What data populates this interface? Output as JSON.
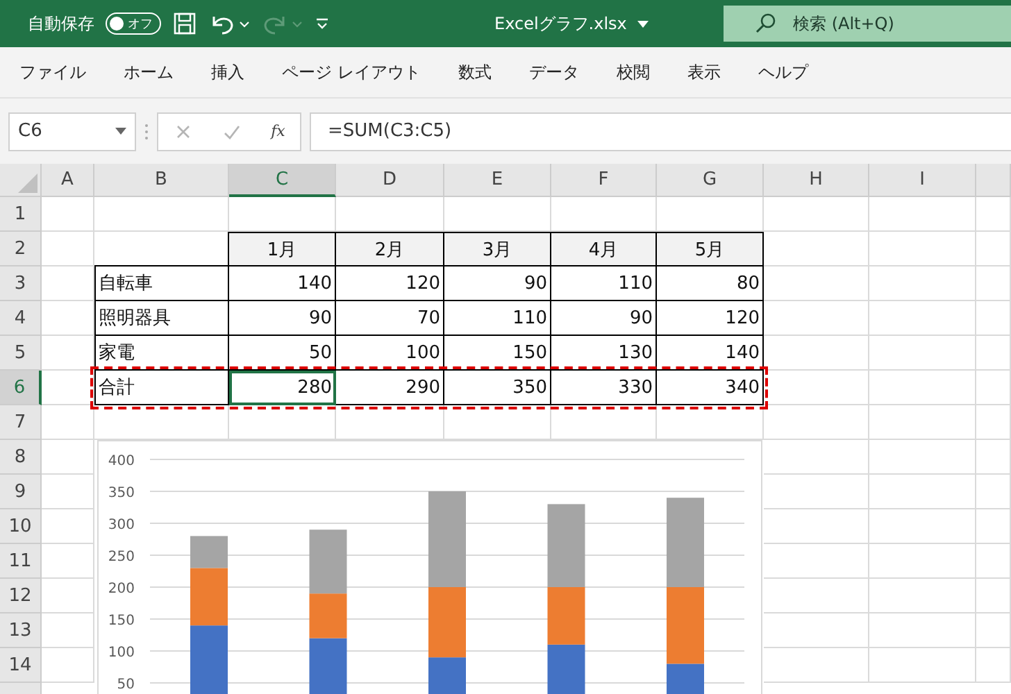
{
  "title_bar": {
    "autosave_label": "自動保存",
    "autosave": {
      "on": false,
      "label": "オフ"
    },
    "file_name": "Excelグラフ.xlsx",
    "search": {
      "placeholder": "検索 (Alt+Q)"
    }
  },
  "menu": [
    "ファイル",
    "ホーム",
    "挿入",
    "ページ レイアウト",
    "数式",
    "データ",
    "校閲",
    "表示",
    "ヘルプ"
  ],
  "formula_bar": {
    "name_box": "C6",
    "fx": "fx",
    "formula": "=SUM(C3:C5)"
  },
  "columns": [
    {
      "label": "A",
      "selected": false
    },
    {
      "label": "B",
      "selected": false
    },
    {
      "label": "C",
      "selected": true
    },
    {
      "label": "D",
      "selected": false
    },
    {
      "label": "E",
      "selected": false
    },
    {
      "label": "F",
      "selected": false
    },
    {
      "label": "G",
      "selected": false
    },
    {
      "label": "H",
      "selected": false
    },
    {
      "label": "I",
      "selected": false
    }
  ],
  "rows": [
    {
      "label": "1",
      "selected": false
    },
    {
      "label": "2",
      "selected": false
    },
    {
      "label": "3",
      "selected": false
    },
    {
      "label": "4",
      "selected": false
    },
    {
      "label": "5",
      "selected": false
    },
    {
      "label": "6",
      "selected": true
    },
    {
      "label": "7",
      "selected": false
    },
    {
      "label": "8",
      "selected": false
    },
    {
      "label": "9",
      "selected": false
    },
    {
      "label": "10",
      "selected": false
    },
    {
      "label": "11",
      "selected": false
    },
    {
      "label": "12",
      "selected": false
    },
    {
      "label": "13",
      "selected": false
    },
    {
      "label": "14",
      "selected": false
    }
  ],
  "table": {
    "header": [
      "1月",
      "2月",
      "3月",
      "4月",
      "5月"
    ],
    "rows": [
      {
        "label": "自転車",
        "outlined": false,
        "cells": [
          {
            "value": "140",
            "selected": false
          },
          {
            "value": "120",
            "selected": false
          },
          {
            "value": "90",
            "selected": false
          },
          {
            "value": "110",
            "selected": false
          },
          {
            "value": "80",
            "selected": false
          }
        ]
      },
      {
        "label": "照明器具",
        "outlined": false,
        "cells": [
          {
            "value": "90",
            "selected": false
          },
          {
            "value": "70",
            "selected": false
          },
          {
            "value": "110",
            "selected": false
          },
          {
            "value": "90",
            "selected": false
          },
          {
            "value": "120",
            "selected": false
          }
        ]
      },
      {
        "label": "家電",
        "outlined": false,
        "cells": [
          {
            "value": "50",
            "selected": false
          },
          {
            "value": "100",
            "selected": false
          },
          {
            "value": "150",
            "selected": false
          },
          {
            "value": "130",
            "selected": false
          },
          {
            "value": "140",
            "selected": false
          }
        ]
      },
      {
        "label": "合計",
        "outlined": true,
        "cells": [
          {
            "value": "280",
            "selected": true
          },
          {
            "value": "290",
            "selected": false
          },
          {
            "value": "350",
            "selected": false
          },
          {
            "value": "330",
            "selected": false
          },
          {
            "value": "340",
            "selected": false
          }
        ]
      }
    ]
  },
  "chart": {
    "chart_data": {
      "type": "bar",
      "stacked": true,
      "grid": true,
      "ylim": [
        0,
        400
      ],
      "yticks": [
        50,
        100,
        150,
        200,
        250,
        300,
        350,
        400
      ],
      "series": [
        {
          "color": "#4472c4",
          "values": [
            140,
            120,
            90,
            110,
            80
          ]
        },
        {
          "color": "#ed7d31",
          "values": [
            90,
            70,
            110,
            90,
            120
          ]
        },
        {
          "color": "#a5a5a5",
          "values": [
            50,
            100,
            150,
            130,
            140
          ]
        }
      ]
    }
  }
}
